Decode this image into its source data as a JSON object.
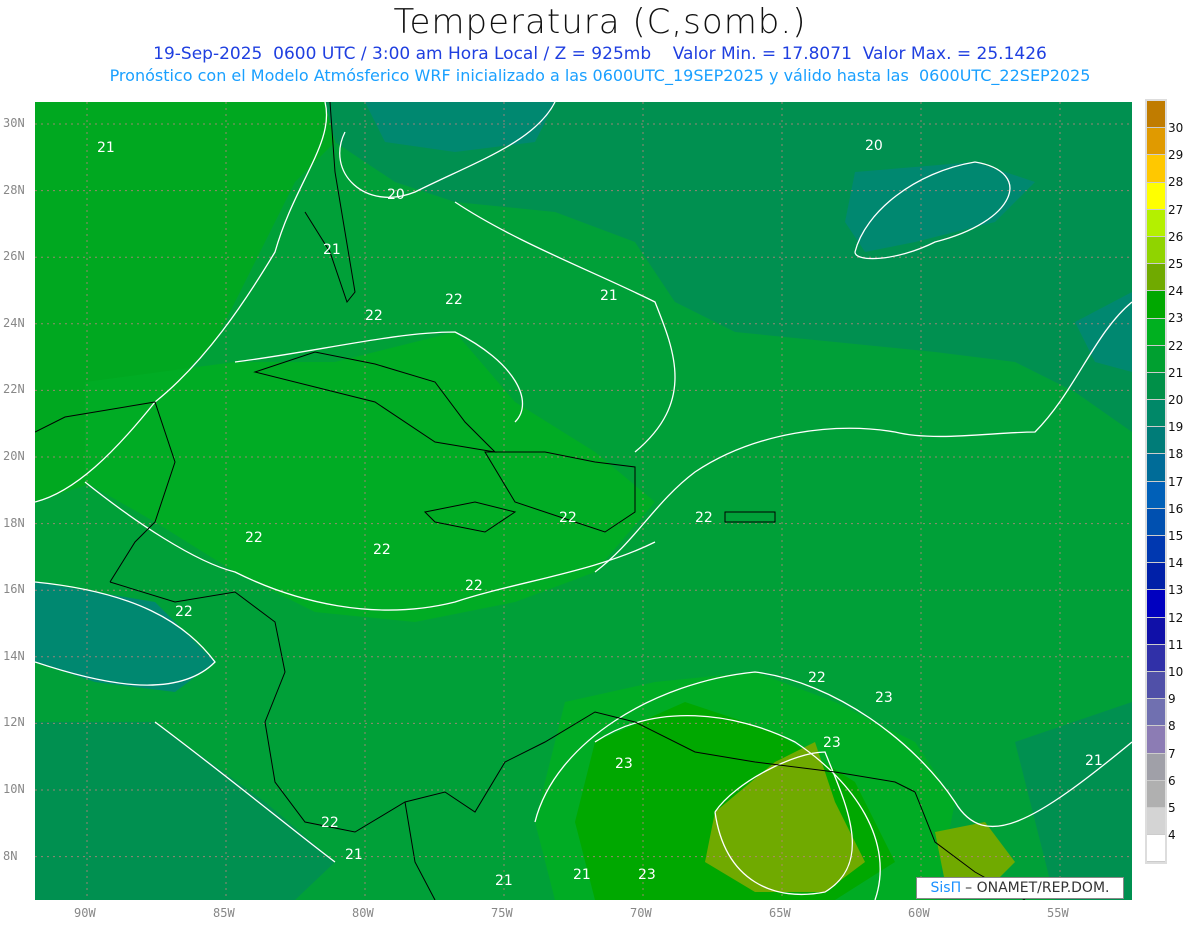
{
  "header": {
    "title": "Temperatura (C,somb.)",
    "subtitle1": "19-Sep-2025  0600 UTC / 3:00 am Hora Local / Z = 925mb    Valor Min. = 17.8071  Valor Max. = 25.1426",
    "subtitle2": "Pronóstico con el Modelo Atmósferico WRF inicializado a las 0600UTC_19SEP2025 y válido hasta las  0600UTC_22SEP2025"
  },
  "axes": {
    "lon_labels": [
      "90W",
      "85W",
      "80W",
      "75W",
      "70W",
      "65W",
      "60W",
      "55W"
    ],
    "lat_labels": [
      "30N",
      "28N",
      "26N",
      "24N",
      "22N",
      "20N",
      "18N",
      "16N",
      "14N",
      "12N",
      "10N",
      "8N"
    ]
  },
  "colorbar": {
    "labels": [
      "30",
      "29",
      "28",
      "27",
      "26",
      "25",
      "24",
      "23",
      "22",
      "21",
      "20",
      "19",
      "18",
      "17",
      "16",
      "15",
      "14",
      "13",
      "12",
      "11",
      "10",
      "9",
      "8",
      "7",
      "6",
      "5",
      "4"
    ],
    "colors": [
      "#c07c00",
      "#e09a00",
      "#ffc800",
      "#ffff00",
      "#b4f000",
      "#90d400",
      "#70aa00",
      "#00a800",
      "#00b020",
      "#00a030",
      "#009048",
      "#008868",
      "#007c78",
      "#006c98",
      "#0060b8",
      "#0050b0",
      "#0038b0",
      "#0020a8",
      "#0000c0",
      "#1010a8",
      "#3030a8",
      "#5050a8",
      "#7070b0",
      "#8c7cb4",
      "#a0a0a8",
      "#b0b0b0",
      "#d4d4d4",
      "#ffffff"
    ]
  },
  "contour_labels": [
    "21",
    "20",
    "20",
    "21",
    "22",
    "22",
    "21",
    "22",
    "22",
    "22",
    "22",
    "22",
    "22",
    "22",
    "23",
    "23",
    "23",
    "21",
    "21",
    "21",
    "22",
    "21",
    "23"
  ],
  "logo": {
    "brand": "SisΠ",
    "text": "– ONAMET/REP.DOM."
  }
}
